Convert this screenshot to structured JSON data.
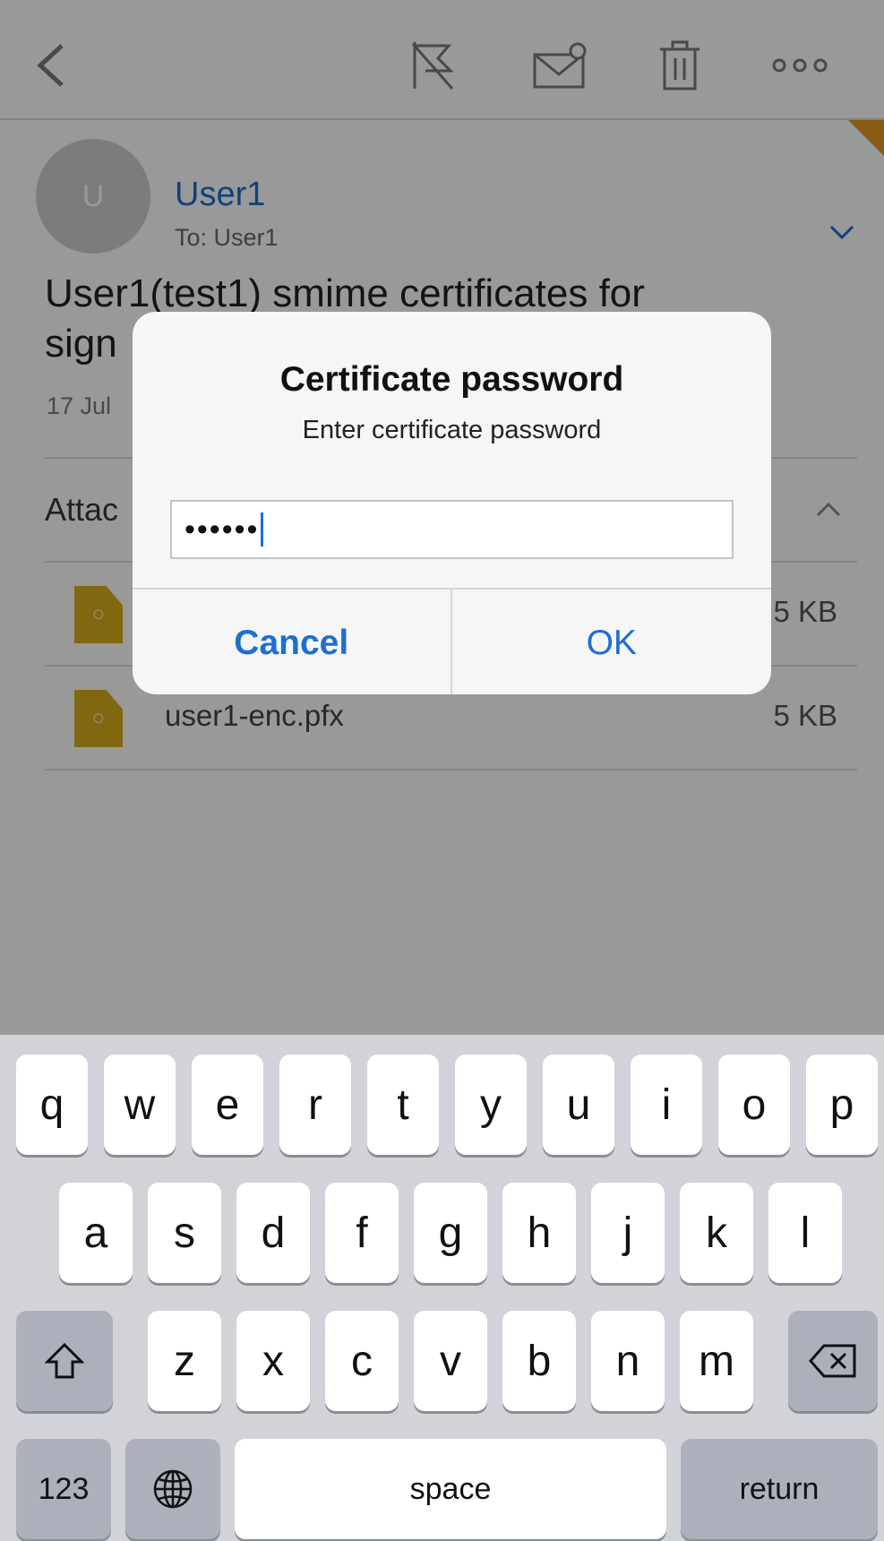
{
  "header": {
    "back_icon": "chevron-left-icon",
    "flag_icon": "flag-icon",
    "mark_unread_icon": "envelope-icon",
    "delete_icon": "trash-icon",
    "more_icon": "ellipsis-icon",
    "accent_color": "#e29a1e"
  },
  "message": {
    "avatar_initial": "U",
    "sender": "User1",
    "to": "To: User1",
    "subject_line1": "User1(test1) smime certificates for",
    "subject_line2": "sign",
    "date": "17 Jul",
    "attachments_label": "Attac"
  },
  "attachments": [
    {
      "name": "",
      "size": "5 KB",
      "icon": "certificate-file-icon"
    },
    {
      "name": "user1-enc.pfx",
      "size": "5 KB",
      "icon": "certificate-file-icon"
    }
  ],
  "dialog": {
    "title": "Certificate password",
    "message": "Enter certificate password",
    "password_value": "••••••",
    "cancel_label": "Cancel",
    "ok_label": "OK"
  },
  "keyboard": {
    "row1": [
      "q",
      "w",
      "e",
      "r",
      "t",
      "y",
      "u",
      "i",
      "o",
      "p"
    ],
    "row2": [
      "a",
      "s",
      "d",
      "f",
      "g",
      "h",
      "j",
      "k",
      "l"
    ],
    "row3": [
      "z",
      "x",
      "c",
      "v",
      "b",
      "n",
      "m"
    ],
    "numbers_label": "123",
    "space_label": "space",
    "return_label": "return",
    "shift_icon": "shift-arrow-icon",
    "delete_icon": "backspace-icon",
    "globe_icon": "globe-icon"
  },
  "colors": {
    "link_blue": "#1d6fd1",
    "file_icon": "#d7ad1c"
  }
}
